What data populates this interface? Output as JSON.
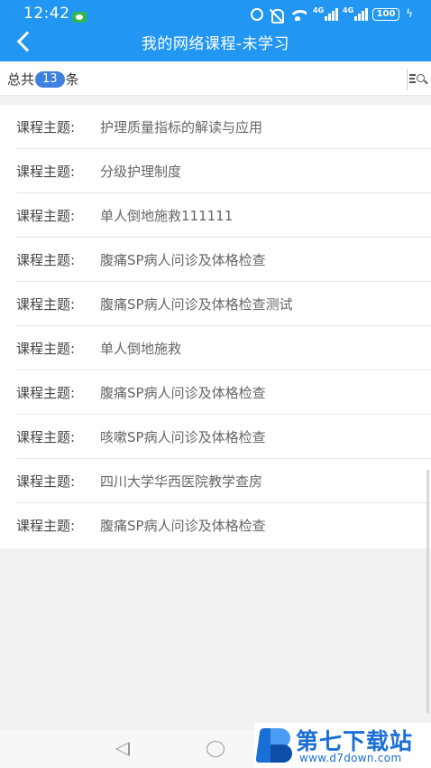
{
  "status_bar": {
    "time": "12:42",
    "signal_label_1": "4G",
    "signal_label_2": "4G",
    "battery": "100"
  },
  "header": {
    "title": "我的网络课程-未学习"
  },
  "summary": {
    "prefix": "总共",
    "count": "13",
    "suffix": "条"
  },
  "courses": {
    "label": "课程主题:",
    "items": [
      {
        "title": "护理质量指标的解读与应用"
      },
      {
        "title": "分级护理制度"
      },
      {
        "title": "单人倒地施救111111"
      },
      {
        "title": "腹痛SP病人问诊及体格检查"
      },
      {
        "title": "腹痛SP病人问诊及体格检查测试"
      },
      {
        "title": "单人倒地施救"
      },
      {
        "title": "腹痛SP病人问诊及体格检查"
      },
      {
        "title": "咳嗽SP病人问诊及体格检查"
      },
      {
        "title": "四川大学华西医院教学查房"
      },
      {
        "title": "腹痛SP病人问诊及体格检查"
      }
    ]
  },
  "watermark": {
    "name": "第七下载站",
    "url": "www.d7down.com"
  },
  "colors": {
    "header": "#2196f3",
    "badge": "#3f7fe0",
    "watermark": "#1a6fd6"
  }
}
